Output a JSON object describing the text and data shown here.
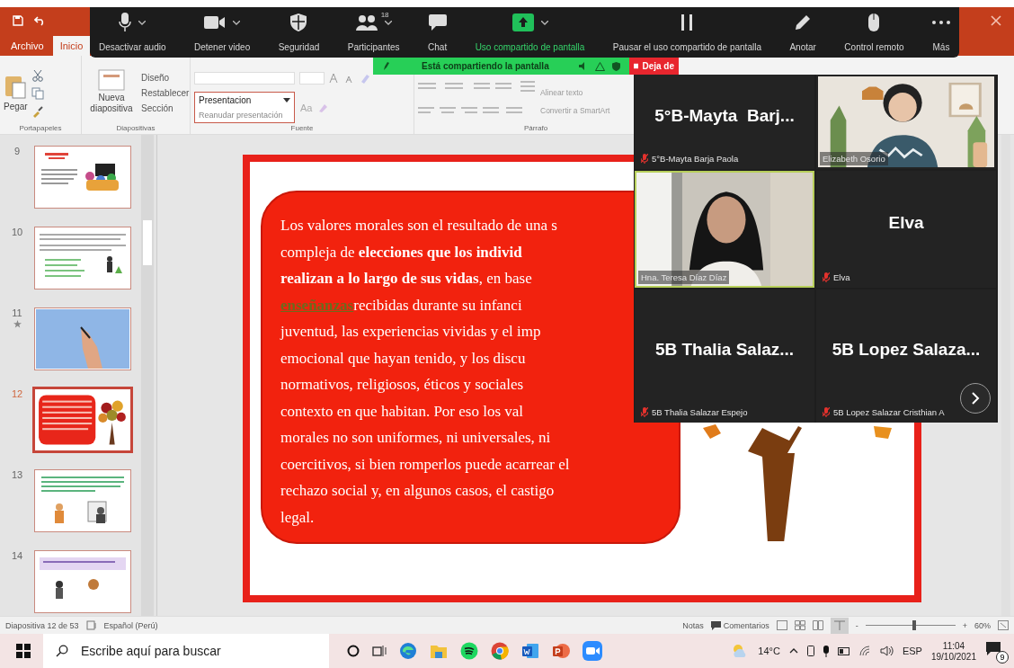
{
  "powerpoint": {
    "tabs": [
      {
        "label": "Archivo",
        "selected": false
      },
      {
        "label": "Inicio",
        "selected": true
      }
    ],
    "ribbon": {
      "paste": "Pegar",
      "new_slide": "Nueva diapositiva",
      "layout": "Diseño",
      "reset": "Restablecer",
      "section": "Sección",
      "presentation_dropdown": {
        "value": "Presentacion",
        "item": "Reanudar presentación"
      },
      "change_case": "Aa",
      "align_text": "Alinear texto",
      "smartart": "Convertir a SmartArt",
      "groups": [
        {
          "label": "Portapapeles"
        },
        {
          "label": "Diapositivas"
        },
        {
          "label": "Fuente"
        },
        {
          "label": "Párrafo"
        }
      ]
    },
    "slides": [
      {
        "number": "9",
        "kind": "text-picture",
        "selected": false,
        "animated": false
      },
      {
        "number": "10",
        "kind": "text-figure",
        "selected": false,
        "animated": false
      },
      {
        "number": "11",
        "kind": "picture",
        "selected": false,
        "animated": true
      },
      {
        "number": "12",
        "kind": "red-box-tree",
        "selected": true,
        "animated": false
      },
      {
        "number": "13",
        "kind": "two-figures",
        "selected": false,
        "animated": false
      },
      {
        "number": "14",
        "kind": "figures-band",
        "selected": false,
        "animated": false
      }
    ],
    "slide": {
      "lines": [
        {
          "text": "Los valores morales son el resultado de una s"
        },
        {
          "text": "compleja de **elecciones que los individ**"
        },
        {
          "text": "**realizan a lo largo de sus vidas**, en base"
        },
        {
          "link": "enseñanzas",
          "text": "recibidas durante su infanci"
        },
        {
          "text": "juventud, las experiencias vividas y el imp"
        },
        {
          "text": "emocional que hayan tenido, y los discu"
        },
        {
          "text": "normativos, religiosos, éticos y sociales"
        },
        {
          "text": "contexto en que habitan. Por eso los val"
        },
        {
          "text": "morales no son uniformes, ni universales, ni"
        },
        {
          "text": "coercitivos, si bien romperlos puede acarrear el"
        },
        {
          "text": "rechazo social y, en algunos casos, el castigo"
        },
        {
          "text": "legal."
        }
      ]
    },
    "status_bar": {
      "slide_count": "Diapositiva 12 de 53",
      "language": "Español (Perú)",
      "notes": "Notas",
      "comments": "Comentarios",
      "zoom_minus": "-",
      "zoom_plus": "+",
      "zoom": "60%",
      "level": 0.54
    }
  },
  "zoom": {
    "toolbar": [
      {
        "label": "Desactivar audio",
        "kind": "mic",
        "caret": true,
        "active": false
      },
      {
        "label": "Detener video",
        "kind": "camera",
        "caret": true,
        "active": false
      },
      {
        "label": "Seguridad",
        "kind": "shield",
        "caret": false,
        "active": false
      },
      {
        "label": "Participantes",
        "kind": "people",
        "caret": true,
        "active": false,
        "count": "18"
      },
      {
        "label": "Chat",
        "kind": "chat",
        "caret": false,
        "active": false
      },
      {
        "label": "Uso compartido de pantalla",
        "kind": "share",
        "caret": true,
        "active": true
      },
      {
        "label": "Pausar el uso compartido de pantalla",
        "kind": "pause",
        "caret": false,
        "active": false
      },
      {
        "label": "Anotar",
        "kind": "pencil",
        "caret": false,
        "active": false
      },
      {
        "label": "Control remoto",
        "kind": "mouse",
        "caret": false,
        "active": false
      },
      {
        "label": "Más",
        "kind": "more",
        "caret": false,
        "active": false
      }
    ],
    "share_banner": "Está compartiendo la pantalla",
    "stop_button": "Deja de",
    "tiles": [
      {
        "kind": "name",
        "display_name": "5°B-Mayta  Barj...",
        "label": "5°B-Mayta Barja Paola",
        "muted": true,
        "speaking": false
      },
      {
        "kind": "video-woman",
        "label": "Elizabeth Osorio",
        "muted": false,
        "speaking": false
      },
      {
        "kind": "video-nun",
        "label": "Hna. Teresa Díaz Díaz",
        "muted": false,
        "speaking": true
      },
      {
        "kind": "name",
        "display_name": "Elva",
        "label": "Elva",
        "muted": true,
        "speaking": false
      },
      {
        "kind": "name",
        "display_name": "5B Thalia Salaz...",
        "label": "5B Thalia Salazar Espejo",
        "muted": true,
        "speaking": false
      },
      {
        "kind": "name",
        "display_name": "5B Lopez Salaza...",
        "label": "5B Lopez Salazar Cristhian A",
        "muted": true,
        "speaking": false
      }
    ]
  },
  "taskbar": {
    "search": {
      "placeholder": "Escribe aquí para buscar"
    },
    "temperature": "14°C",
    "keyboard": "ESP",
    "time": "11:04",
    "date": "19/10/2021",
    "notifications": "9"
  }
}
